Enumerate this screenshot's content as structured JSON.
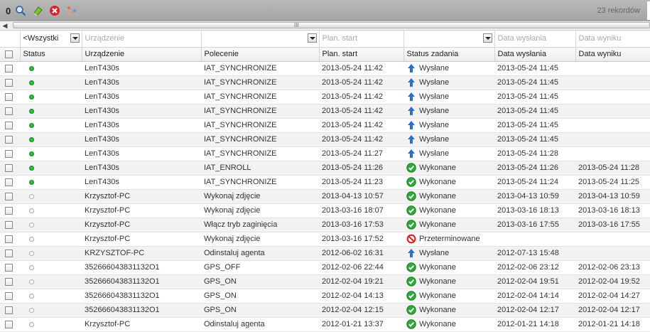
{
  "toolbar": {
    "count": "0",
    "records": "23 rekordów",
    "icons": [
      "search-icon",
      "eraser-icon",
      "delete-icon",
      "network-icon"
    ]
  },
  "scroll": {
    "left_arrow": "◀",
    "grip": "III"
  },
  "filters": {
    "status": "<Wszystki",
    "device": "Urządzenie",
    "command": "",
    "plan_start": "Plan. start",
    "task_status": "",
    "sent_date": "Data wysłania",
    "result_date": "Data wyniku"
  },
  "columns": [
    "Status",
    "Urządzenie",
    "Polecenie",
    "Plan. start",
    "Status zadania",
    "Data wysłania",
    "Data wyniku"
  ],
  "colors": {
    "sent": "#2b6fd1",
    "done": "#2faa3a",
    "expired": "#d81b1b"
  },
  "rows": [
    {
      "active": true,
      "device": "LenT430s",
      "command": "IAT_SYNCHRONIZE",
      "plan": "2013-05-24 11:42",
      "status": "Wysłane",
      "kind": "sent",
      "sent": "2013-05-24 11:45",
      "result": ""
    },
    {
      "active": true,
      "device": "LenT430s",
      "command": "IAT_SYNCHRONIZE",
      "plan": "2013-05-24 11:42",
      "status": "Wysłane",
      "kind": "sent",
      "sent": "2013-05-24 11:45",
      "result": ""
    },
    {
      "active": true,
      "device": "LenT430s",
      "command": "IAT_SYNCHRONIZE",
      "plan": "2013-05-24 11:42",
      "status": "Wysłane",
      "kind": "sent",
      "sent": "2013-05-24 11:45",
      "result": ""
    },
    {
      "active": true,
      "device": "LenT430s",
      "command": "IAT_SYNCHRONIZE",
      "plan": "2013-05-24 11:42",
      "status": "Wysłane",
      "kind": "sent",
      "sent": "2013-05-24 11:45",
      "result": ""
    },
    {
      "active": true,
      "device": "LenT430s",
      "command": "IAT_SYNCHRONIZE",
      "plan": "2013-05-24 11:42",
      "status": "Wysłane",
      "kind": "sent",
      "sent": "2013-05-24 11:45",
      "result": ""
    },
    {
      "active": true,
      "device": "LenT430s",
      "command": "IAT_SYNCHRONIZE",
      "plan": "2013-05-24 11:42",
      "status": "Wysłane",
      "kind": "sent",
      "sent": "2013-05-24 11:45",
      "result": ""
    },
    {
      "active": true,
      "device": "LenT430s",
      "command": "IAT_SYNCHRONIZE",
      "plan": "2013-05-24 11:27",
      "status": "Wysłane",
      "kind": "sent",
      "sent": "2013-05-24 11:28",
      "result": ""
    },
    {
      "active": true,
      "device": "LenT430s",
      "command": "IAT_ENROLL",
      "plan": "2013-05-24 11:26",
      "status": "Wykonane",
      "kind": "done",
      "sent": "2013-05-24 11:26",
      "result": "2013-05-24 11:28"
    },
    {
      "active": true,
      "device": "LenT430s",
      "command": "IAT_SYNCHRONIZE",
      "plan": "2013-05-24 11:23",
      "status": "Wykonane",
      "kind": "done",
      "sent": "2013-05-24 11:24",
      "result": "2013-05-24 11:25"
    },
    {
      "active": false,
      "device": "Krzysztof-PC",
      "command": "Wykonaj zdjęcie",
      "plan": "2013-04-13 10:57",
      "status": "Wykonane",
      "kind": "done",
      "sent": "2013-04-13 10:59",
      "result": "2013-04-13 10:59"
    },
    {
      "active": false,
      "device": "Krzysztof-PC",
      "command": "Wykonaj zdjęcie",
      "plan": "2013-03-16 18:07",
      "status": "Wykonane",
      "kind": "done",
      "sent": "2013-03-16 18:13",
      "result": "2013-03-16 18:13"
    },
    {
      "active": false,
      "device": "Krzysztof-PC",
      "command": "Włącz tryb zaginięcia",
      "plan": "2013-03-16 17:53",
      "status": "Wykonane",
      "kind": "done",
      "sent": "2013-03-16 17:55",
      "result": "2013-03-16 17:55"
    },
    {
      "active": false,
      "device": "Krzysztof-PC",
      "command": "Wykonaj zdjęcie",
      "plan": "2013-03-16 17:52",
      "status": "Przeterminowane",
      "kind": "expired",
      "sent": "",
      "result": ""
    },
    {
      "active": false,
      "device": "KRZYSZTOF-PC",
      "command": "Odinstaluj agenta",
      "plan": "2012-06-02 16:31",
      "status": "Wysłane",
      "kind": "sent",
      "sent": "2012-07-13 15:48",
      "result": ""
    },
    {
      "active": false,
      "device": "352666043831132O1",
      "command": "GPS_OFF",
      "plan": "2012-02-06 22:44",
      "status": "Wykonane",
      "kind": "done",
      "sent": "2012-02-06 23:12",
      "result": "2012-02-06 23:13"
    },
    {
      "active": false,
      "device": "352666043831132O1",
      "command": "GPS_ON",
      "plan": "2012-02-04 19:21",
      "status": "Wykonane",
      "kind": "done",
      "sent": "2012-02-04 19:51",
      "result": "2012-02-04 19:52"
    },
    {
      "active": false,
      "device": "352666043831132O1",
      "command": "GPS_ON",
      "plan": "2012-02-04 14:13",
      "status": "Wykonane",
      "kind": "done",
      "sent": "2012-02-04 14:14",
      "result": "2012-02-04 14:27"
    },
    {
      "active": false,
      "device": "352666043831132O1",
      "command": "GPS_ON",
      "plan": "2012-02-04 12:15",
      "status": "Wykonane",
      "kind": "done",
      "sent": "2012-02-04 12:17",
      "result": "2012-02-04 12:17"
    },
    {
      "active": false,
      "device": "Krzysztof-PC",
      "command": "Odinstaluj agenta",
      "plan": "2012-01-21 13:37",
      "status": "Wykonane",
      "kind": "done",
      "sent": "2012-01-21 14:18",
      "result": "2012-01-21 14:18"
    }
  ]
}
